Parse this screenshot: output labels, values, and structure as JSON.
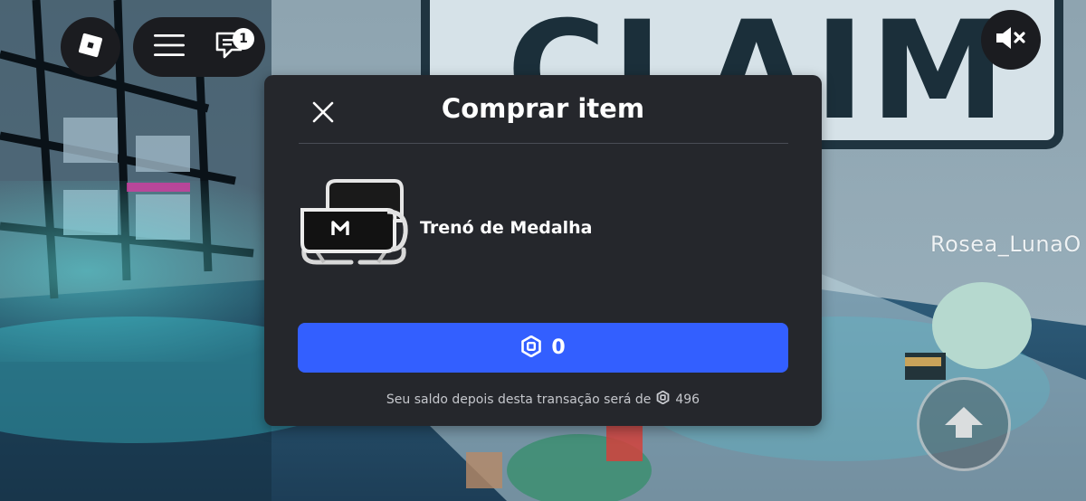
{
  "hud": {
    "roblox_icon": "roblox-logo-icon",
    "menu_icon": "hamburger-menu-icon",
    "chat_icon": "chat-icon",
    "chat_badge_count": "1",
    "mute_icon": "speaker-muted-icon",
    "jump_icon": "jump-arrow-icon"
  },
  "scene": {
    "sign_text": "CLAIM",
    "player_name": "Rosea_LunaO"
  },
  "purchase_dialog": {
    "title": "Comprar item",
    "close_icon": "close-icon",
    "item_name": "Trenó de Medalha",
    "item_thumbnail_icon": "sled-item-icon",
    "price": "0",
    "currency_icon": "robux-icon",
    "balance_text": "Seu saldo depois desta transação será de",
    "balance_after": "496"
  },
  "colors": {
    "dialog_background": "#25272c",
    "buy_button": "#335fff",
    "hud_background": "#1b1c20"
  }
}
